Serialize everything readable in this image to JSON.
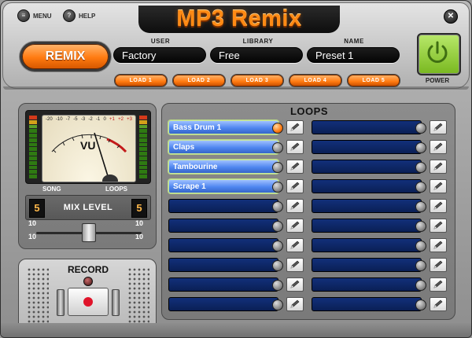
{
  "header": {
    "title": "MP3 Remix",
    "menu_label": "MENU",
    "help_label": "HELP",
    "remix_label": "REMIX",
    "user_label": "USER",
    "library_label": "LIBRARY",
    "name_label": "NAME",
    "user_value": "Factory",
    "library_value": "Free",
    "name_value": "Preset 1",
    "power_label": "POWER",
    "load_buttons": [
      "LOAD 1",
      "LOAD 2",
      "LOAD 3",
      "LOAD 4",
      "LOAD 5"
    ]
  },
  "meter": {
    "vu_label": "VU",
    "scale_labels": [
      "-20",
      "-10",
      "-7",
      "-5",
      "-3",
      "-2",
      "-1",
      "0",
      "+1",
      "+2",
      "+3"
    ]
  },
  "mix": {
    "song_label": "SONG",
    "loops_label": "LOOPS",
    "mix_level_label": "MIX LEVEL",
    "song_value": "5",
    "loops_value": "5",
    "slider_left": "10",
    "slider_right": "10"
  },
  "record": {
    "label": "RECORD"
  },
  "loops": {
    "title": "LOOPS",
    "left_column": [
      {
        "name": "Bass Drum 1",
        "active": true,
        "playing": true
      },
      {
        "name": "Claps",
        "active": true,
        "playing": false
      },
      {
        "name": "Tambourine",
        "active": true,
        "playing": false
      },
      {
        "name": "Scrape 1",
        "active": true,
        "playing": false
      },
      {
        "name": "",
        "active": false,
        "playing": false
      },
      {
        "name": "",
        "active": false,
        "playing": false
      },
      {
        "name": "",
        "active": false,
        "playing": false
      },
      {
        "name": "",
        "active": false,
        "playing": false
      },
      {
        "name": "",
        "active": false,
        "playing": false
      },
      {
        "name": "",
        "active": false,
        "playing": false
      }
    ],
    "right_column": [
      {
        "name": "",
        "active": false,
        "playing": false
      },
      {
        "name": "",
        "active": false,
        "playing": false
      },
      {
        "name": "",
        "active": false,
        "playing": false
      },
      {
        "name": "",
        "active": false,
        "playing": false
      },
      {
        "name": "",
        "active": false,
        "playing": false
      },
      {
        "name": "",
        "active": false,
        "playing": false
      },
      {
        "name": "",
        "active": false,
        "playing": false
      },
      {
        "name": "",
        "active": false,
        "playing": false
      },
      {
        "name": "",
        "active": false,
        "playing": false
      },
      {
        "name": "",
        "active": false,
        "playing": false
      }
    ]
  },
  "colors": {
    "accent_orange": "#ff7a10",
    "power_green": "#8fcc35",
    "loop_active": "#4f86f0",
    "loop_empty": "#0a1f55"
  }
}
